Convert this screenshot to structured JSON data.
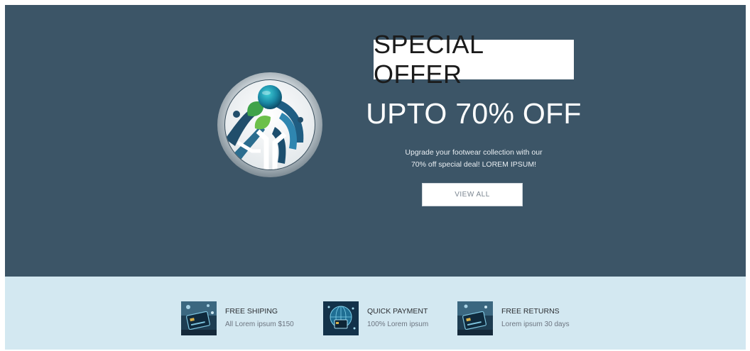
{
  "hero": {
    "badge": "SPECIAL OFFER",
    "headline": "UPTO 70% OFF",
    "description_line1": "Upgrade your footwear collection with our",
    "description_line2": "70% off special deal! LOREM IPSUM!",
    "button_label": "VIEW ALL",
    "background_color": "#3c5567"
  },
  "features": {
    "background_color": "#d3e8f1",
    "items": [
      {
        "title": "FREE SHIPING",
        "subtitle": "All Lorem ipsum $150",
        "icon": "payment-card-icon"
      },
      {
        "title": "QUICK PAYMENT",
        "subtitle": "100% Lorem ipsum",
        "icon": "globe-card-icon"
      },
      {
        "title": "FREE RETURNS",
        "subtitle": "Lorem ipsum 30 days",
        "icon": "payment-card-icon"
      }
    ]
  }
}
